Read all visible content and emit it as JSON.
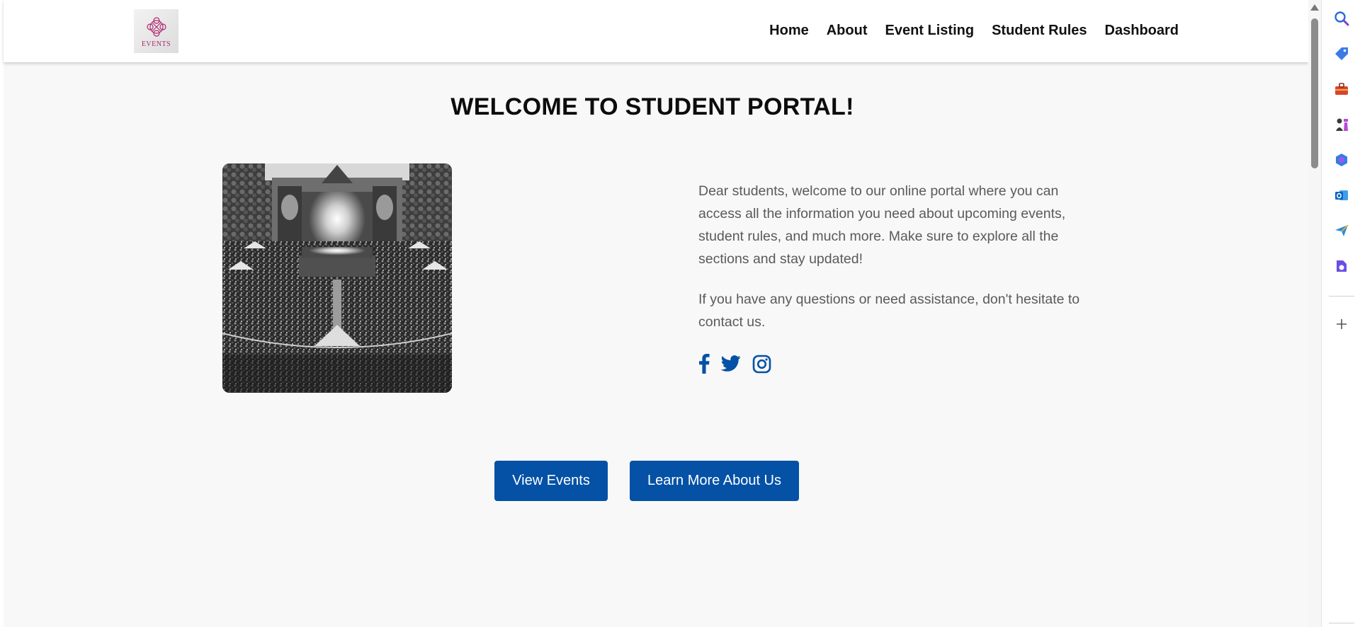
{
  "header": {
    "logo_text": "EVENTS",
    "nav": [
      {
        "label": "Home"
      },
      {
        "label": "About"
      },
      {
        "label": "Event Listing"
      },
      {
        "label": "Student Rules"
      },
      {
        "label": "Dashboard"
      }
    ]
  },
  "main": {
    "title": "WELCOME TO STUDENT PORTAL!",
    "paragraph1": "Dear students, welcome to our online portal where you can access all the information you need about upcoming events, student rules, and much more. Make sure to explore all the sections and stay updated!",
    "paragraph2": "If you have any questions or need assistance, don't hesitate to contact us.",
    "social_icons": [
      "facebook-icon",
      "twitter-icon",
      "instagram-icon"
    ],
    "buttons": {
      "view_events": "View Events",
      "learn_more": "Learn More About Us"
    }
  },
  "side_panel": {
    "icons": [
      "search-icon",
      "tag-icon",
      "briefcase-icon",
      "chess-icon",
      "copilot-icon",
      "outlook-icon",
      "send-icon",
      "drop-icon",
      "add-icon"
    ]
  },
  "colors": {
    "accent": "#0451a6",
    "page_background": "#f8f8f8",
    "logo_accent": "#b0286f"
  }
}
